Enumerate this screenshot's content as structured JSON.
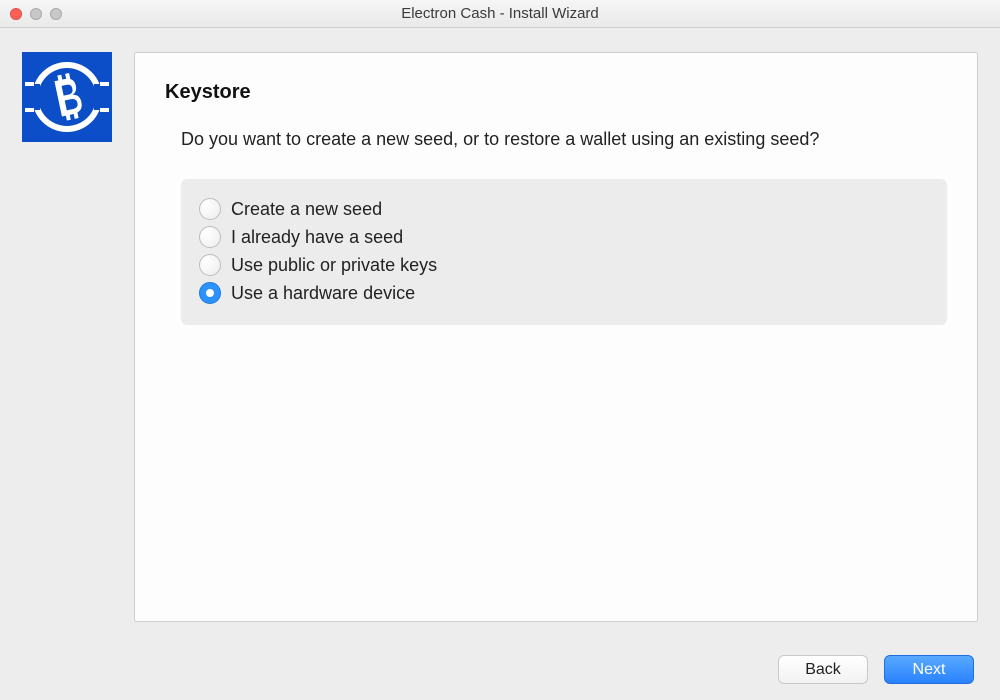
{
  "window": {
    "title": "Electron Cash  -  Install Wizard"
  },
  "panel": {
    "heading": "Keystore",
    "question": "Do you want to create a new seed, or to restore a wallet using an existing seed?"
  },
  "options": [
    {
      "label": "Create a new seed",
      "selected": false
    },
    {
      "label": "I already have a seed",
      "selected": false
    },
    {
      "label": "Use public or private keys",
      "selected": false
    },
    {
      "label": "Use a hardware device",
      "selected": true
    }
  ],
  "buttons": {
    "back": "Back",
    "next": "Next"
  },
  "icons": {
    "logo": "bitcoin-cash-icon"
  }
}
